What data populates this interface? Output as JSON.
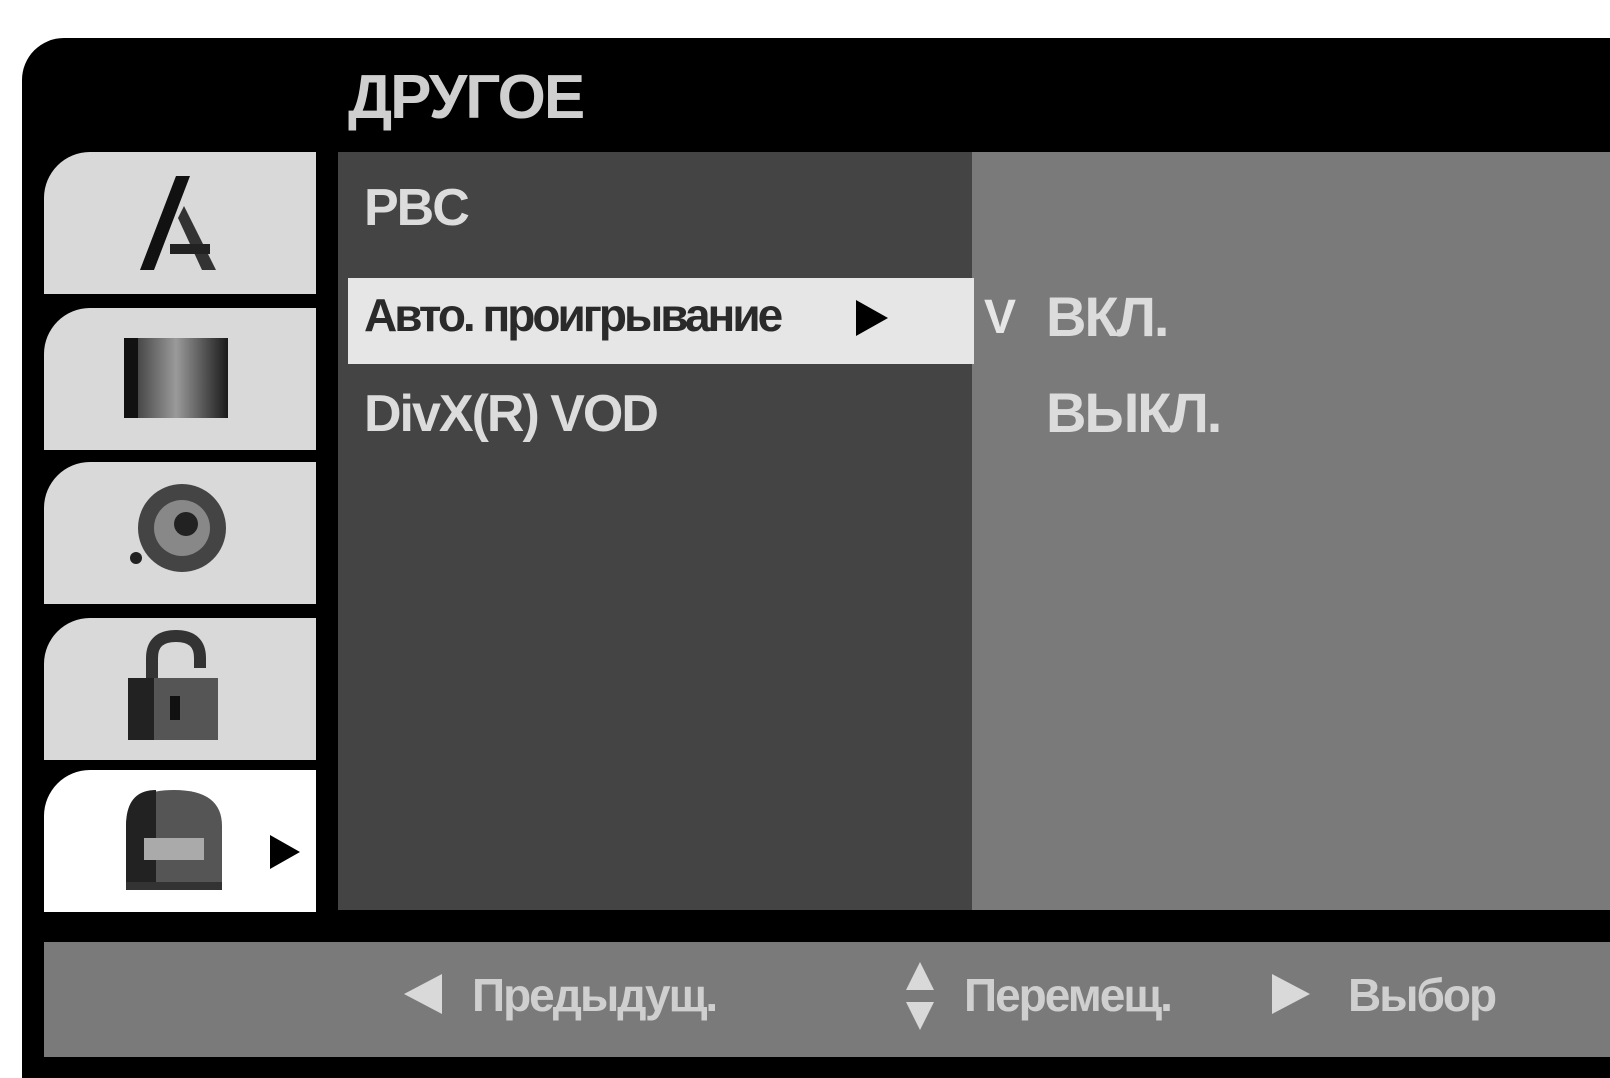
{
  "header": {
    "title": "ДРУГОЕ"
  },
  "sidebar": {
    "tabs": [
      {
        "icon": "language-icon",
        "active": false
      },
      {
        "icon": "display-icon",
        "active": false
      },
      {
        "icon": "audio-icon",
        "active": false
      },
      {
        "icon": "lock-icon",
        "active": false
      },
      {
        "icon": "others-icon",
        "active": true
      }
    ]
  },
  "menu": {
    "items": [
      {
        "label": "PBC"
      },
      {
        "label": "Авто. проигрывание",
        "selected": true
      },
      {
        "label": "DivX(R) VOD"
      }
    ]
  },
  "options": {
    "check_mark": "V",
    "items": [
      {
        "label": "ВКЛ.",
        "checked": true
      },
      {
        "label": "ВЫКЛ.",
        "checked": false
      }
    ]
  },
  "footer": {
    "back": "Предыдущ.",
    "move": "Перемещ.",
    "select": "Выбор"
  }
}
